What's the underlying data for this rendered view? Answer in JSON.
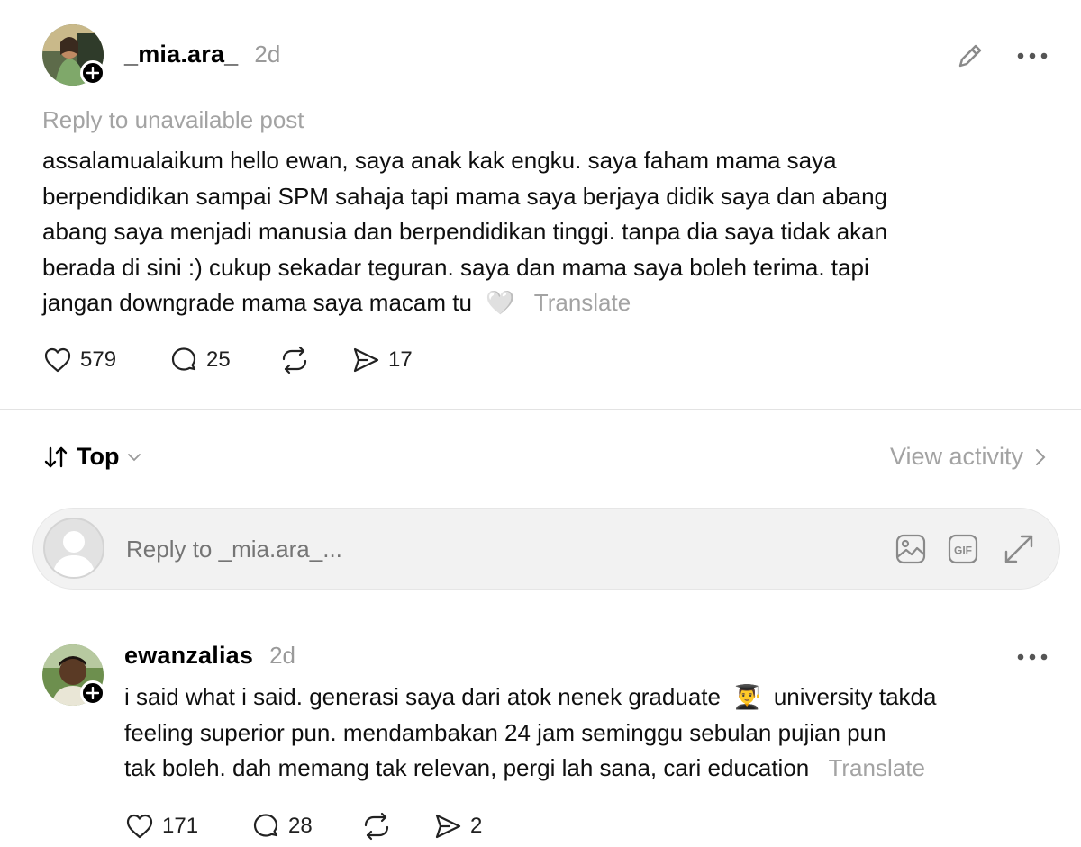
{
  "post": {
    "username": "_mia.ara_",
    "time": "2d",
    "reply_context": "Reply to unavailable post",
    "text_lines": [
      "assalamualaikum hello ewan, saya anak kak engku. saya faham mama saya",
      "berpendidikan sampai SPM sahaja tapi mama saya berjaya didik saya dan abang",
      "abang saya menjadi manusia dan berpendidikan tinggi. tanpa dia saya tidak akan",
      "berada di sini :) cukup sekadar teguran. saya dan mama saya boleh terima. tapi",
      "jangan downgrade mama saya macam tu"
    ],
    "emoji": "🤍",
    "translate": "Translate",
    "likes": "579",
    "replies": "25",
    "shares": "17"
  },
  "sort": {
    "label": "Top",
    "view_activity": "View activity"
  },
  "reply_input": {
    "placeholder": "Reply to _mia.ara_..."
  },
  "reply": {
    "username": "ewanzalias",
    "time": "2d",
    "text_lines": [
      "i said what i said. generasi saya dari atok nenek graduate",
      "feeling superior pun. mendambakan 24 jam seminggu sebulan pujian pun",
      "tak boleh. dah memang tak relevan, pergi lah sana, cari education"
    ],
    "emoji": "👨‍🎓",
    "line1_tail": "university takda",
    "translate": "Translate",
    "likes": "171",
    "replies": "28",
    "shares": "2"
  }
}
